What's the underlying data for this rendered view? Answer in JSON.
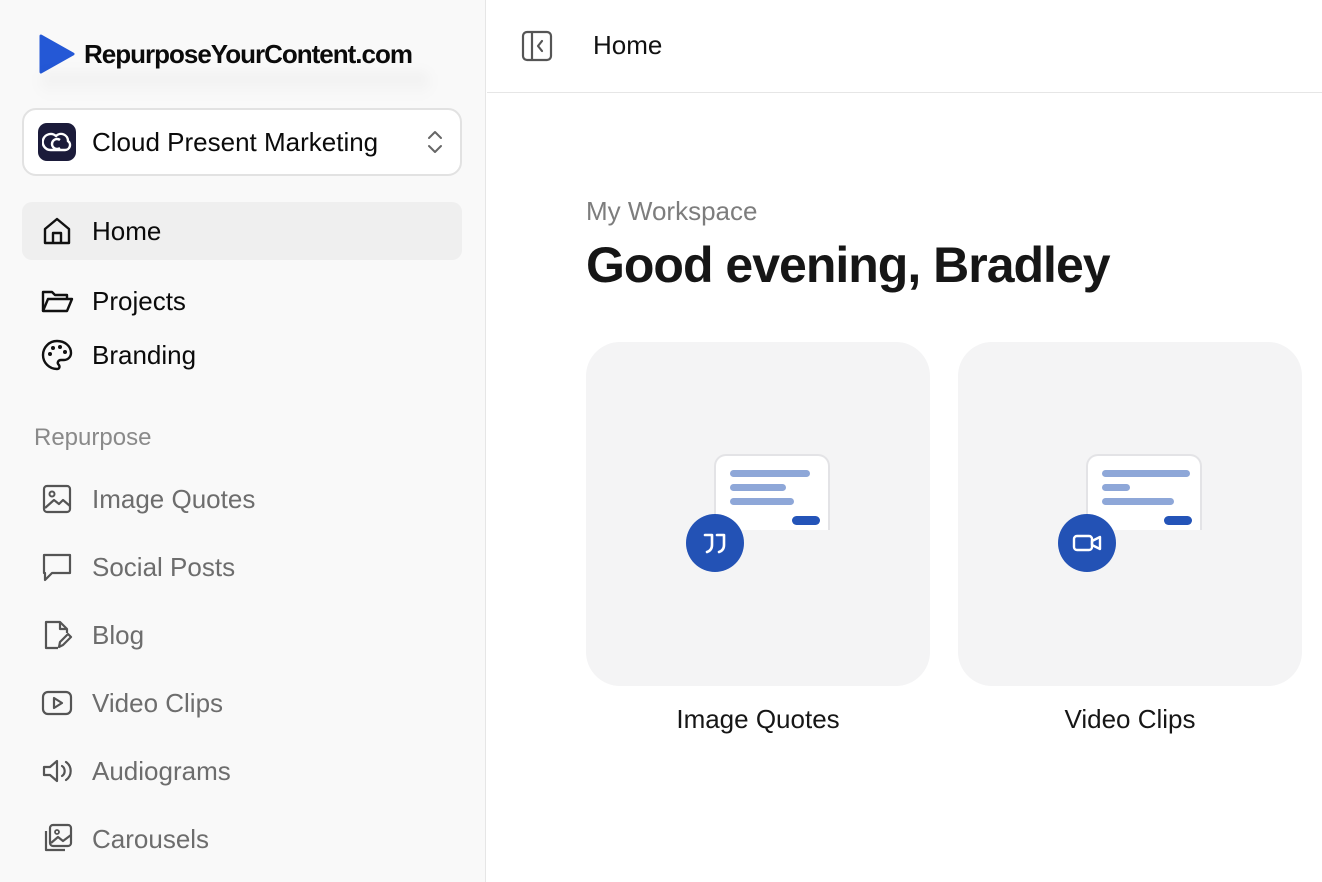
{
  "brand": {
    "name": "RepurposeYourContent.com",
    "accent": "#2458d6"
  },
  "workspace_switcher": {
    "name": "Cloud Present Marketing",
    "avatar_bg": "#1b1b3a"
  },
  "nav": {
    "home": "Home",
    "projects": "Projects",
    "branding": "Branding"
  },
  "repurpose": {
    "section_label": "Repurpose",
    "items": [
      {
        "label": "Image Quotes",
        "icon": "image-icon"
      },
      {
        "label": "Social Posts",
        "icon": "speech-bubble-icon"
      },
      {
        "label": "Blog",
        "icon": "document-edit-icon"
      },
      {
        "label": "Video Clips",
        "icon": "play-icon"
      },
      {
        "label": "Audiograms",
        "icon": "speaker-icon"
      },
      {
        "label": "Carousels",
        "icon": "images-stack-icon"
      }
    ]
  },
  "header": {
    "breadcrumb": "Home"
  },
  "main": {
    "eyebrow": "My Workspace",
    "greeting": "Good evening, Bradley",
    "cards": [
      {
        "label": "Image Quotes",
        "icon": "quote-icon"
      },
      {
        "label": "Video Clips",
        "icon": "video-camera-icon"
      }
    ]
  },
  "colors": {
    "badge_blue": "#2352b5",
    "line_blue": "#8ea7d8"
  }
}
